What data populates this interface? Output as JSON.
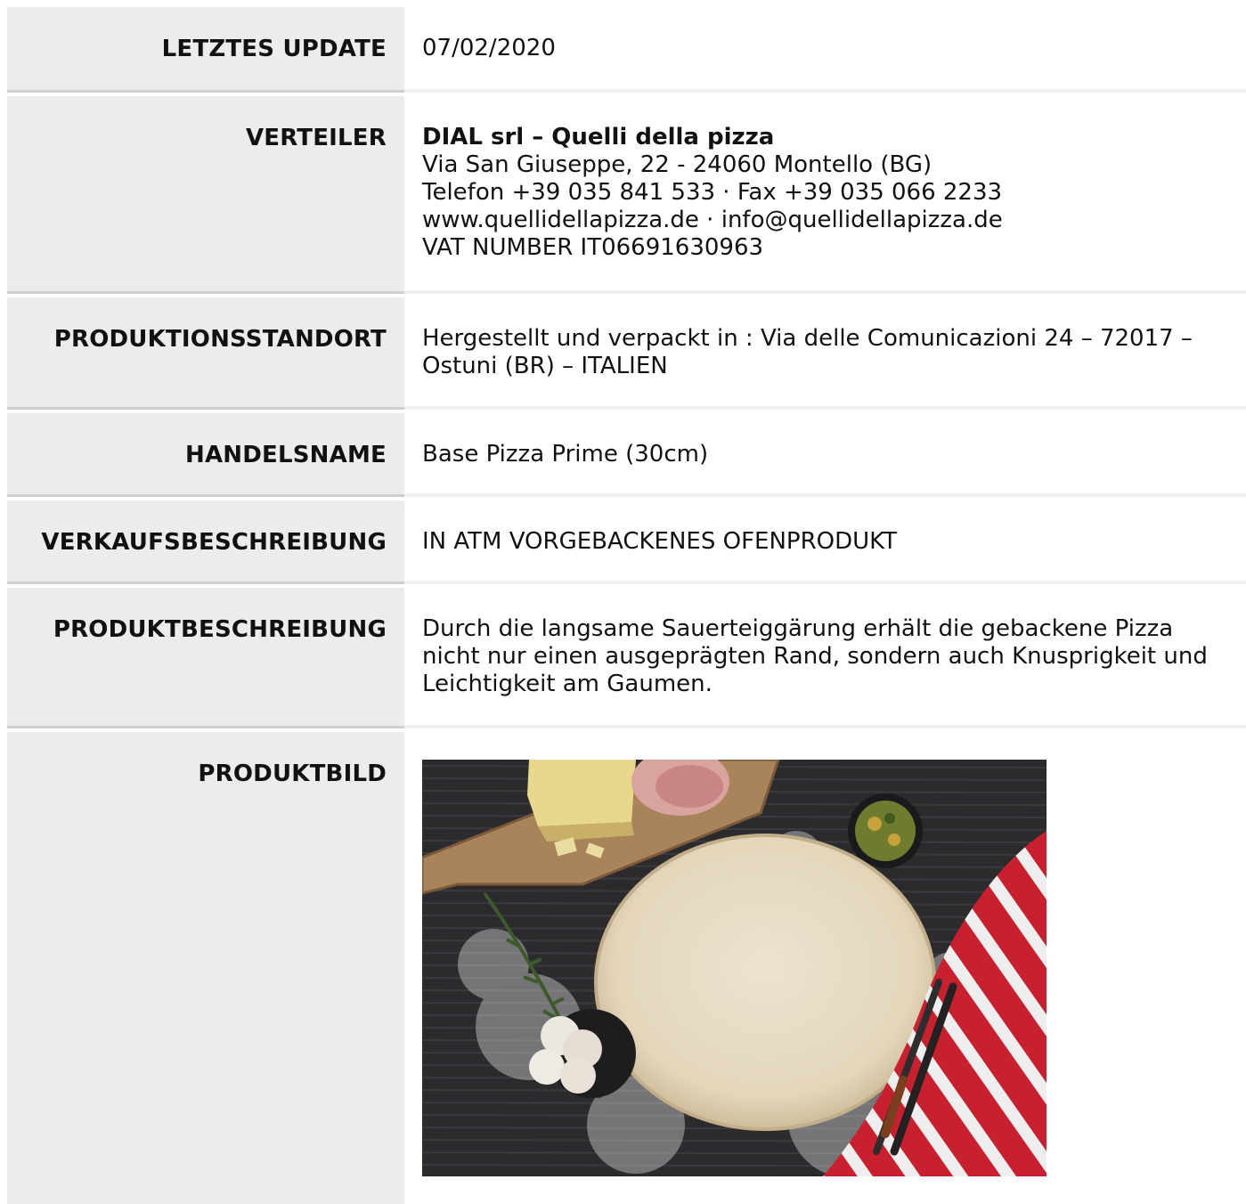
{
  "rows": [
    {
      "label": "LETZTES UPDATE",
      "value": "07/02/2020"
    },
    {
      "label": "VERTEILER",
      "company": "DIAL srl – Quelli della pizza",
      "lines": [
        "Via San Giuseppe, 22 - 24060 Montello (BG)",
        "Telefon +39 035 841 533 · Fax +39 035 066 2233",
        "www.quellidellapizza.de · info@quellidellapizza.de",
        "VAT NUMBER IT06691630963"
      ]
    },
    {
      "label": "PRODUKTIONSSTANDORT",
      "value": "Hergestellt und verpackt in : Via delle Comunicazioni 24 – 72017 – Ostuni (BR) – ITALIEN"
    },
    {
      "label": "HANDELSNAME",
      "value": "Base Pizza Prime (30cm)"
    },
    {
      "label": "VERKAUFSBESCHREIBUNG",
      "value": "IN ATM VORGEBACKENES OFENPRODUKT"
    },
    {
      "label": "PRODUKTBESCHREIBUNG",
      "value": "Durch die langsame Sauerteiggärung erhält die gebackene Pizza nicht nur einen ausgeprägten Rand, sondern auch Knusprigkeit und Leichtigkeit am Gaumen."
    },
    {
      "label": "PRODUKTBILD"
    }
  ],
  "colors": {
    "label_bg": "#ececec",
    "text": "#111111",
    "photo_bg": "#2a2a2c",
    "dough": "#e8dcc4",
    "towel_red": "#c8202e"
  }
}
